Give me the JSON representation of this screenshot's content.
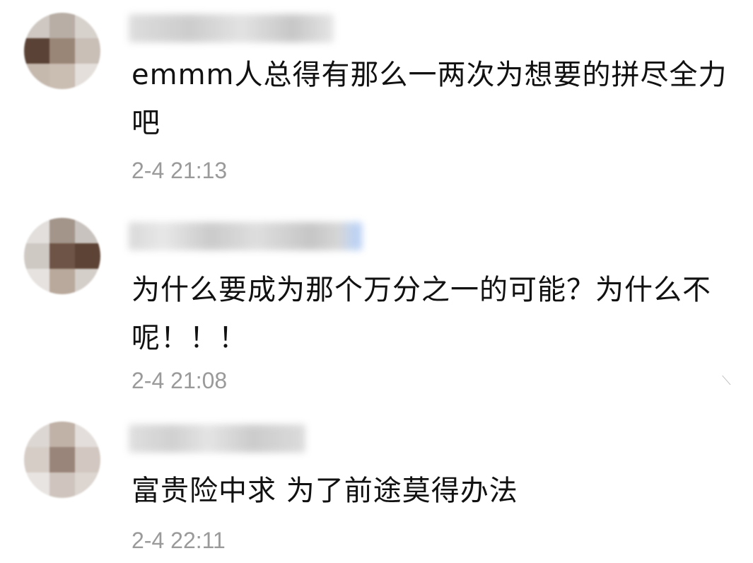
{
  "comments": [
    {
      "text": "emmm人总得有那么一两次为想要的拼尽全力吧",
      "time": "2-4 21:13"
    },
    {
      "text": "为什么要成为那个万分之一的可能？为什么不呢！！！",
      "time": "2-4 21:08"
    },
    {
      "text": "富贵险中求 为了前途莫得办法",
      "time": "2-4 22:11"
    }
  ]
}
